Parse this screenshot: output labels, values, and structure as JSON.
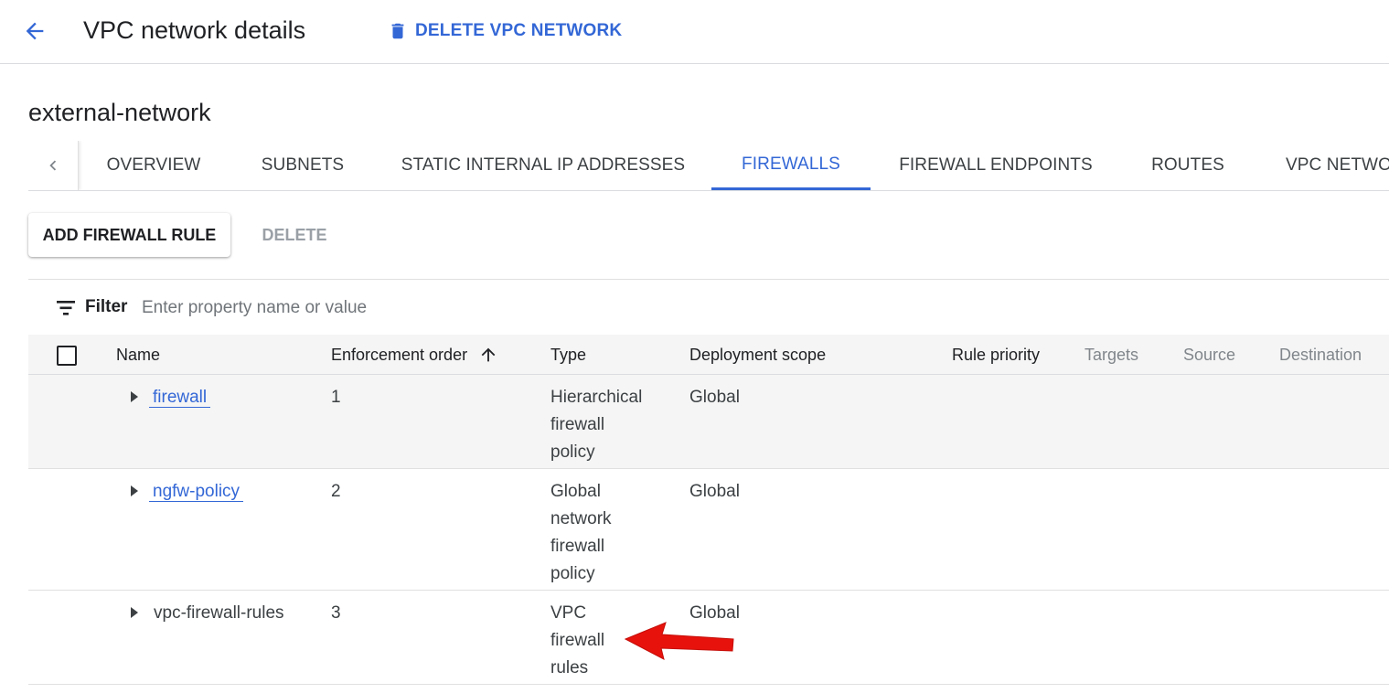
{
  "header": {
    "title": "VPC network details",
    "delete_label": "DELETE VPC NETWORK"
  },
  "network": {
    "name": "external-network"
  },
  "tabs": [
    {
      "label": "OVERVIEW",
      "active": false
    },
    {
      "label": "SUBNETS",
      "active": false
    },
    {
      "label": "STATIC INTERNAL IP ADDRESSES",
      "active": false
    },
    {
      "label": "FIREWALLS",
      "active": true
    },
    {
      "label": "FIREWALL ENDPOINTS",
      "active": false
    },
    {
      "label": "ROUTES",
      "active": false
    },
    {
      "label": "VPC NETWORK PEERING",
      "active": false
    }
  ],
  "toolbar": {
    "add_label": "ADD FIREWALL RULE",
    "delete_label": "DELETE"
  },
  "filter": {
    "label": "Filter",
    "placeholder": "Enter property name or value"
  },
  "table": {
    "columns": {
      "name": "Name",
      "enforcement": "Enforcement order",
      "type": "Type",
      "scope": "Deployment scope",
      "priority": "Rule priority",
      "targets": "Targets",
      "source": "Source",
      "destination": "Destination"
    },
    "rows": [
      {
        "name": "firewall",
        "order": "1",
        "type_lines": [
          "Hierarchical",
          "firewall",
          "policy"
        ],
        "scope": "Global",
        "link": true
      },
      {
        "name": "ngfw-policy",
        "order": "2",
        "type_lines": [
          "Global",
          "network",
          "firewall",
          "policy"
        ],
        "scope": "Global",
        "link": true
      },
      {
        "name": "vpc-firewall-rules",
        "order": "3",
        "type_lines": [
          "VPC",
          "firewall",
          "rules"
        ],
        "scope": "Global",
        "link": false
      }
    ]
  },
  "colors": {
    "accent": "#3367d6",
    "annotation_arrow": "#e8120c"
  }
}
